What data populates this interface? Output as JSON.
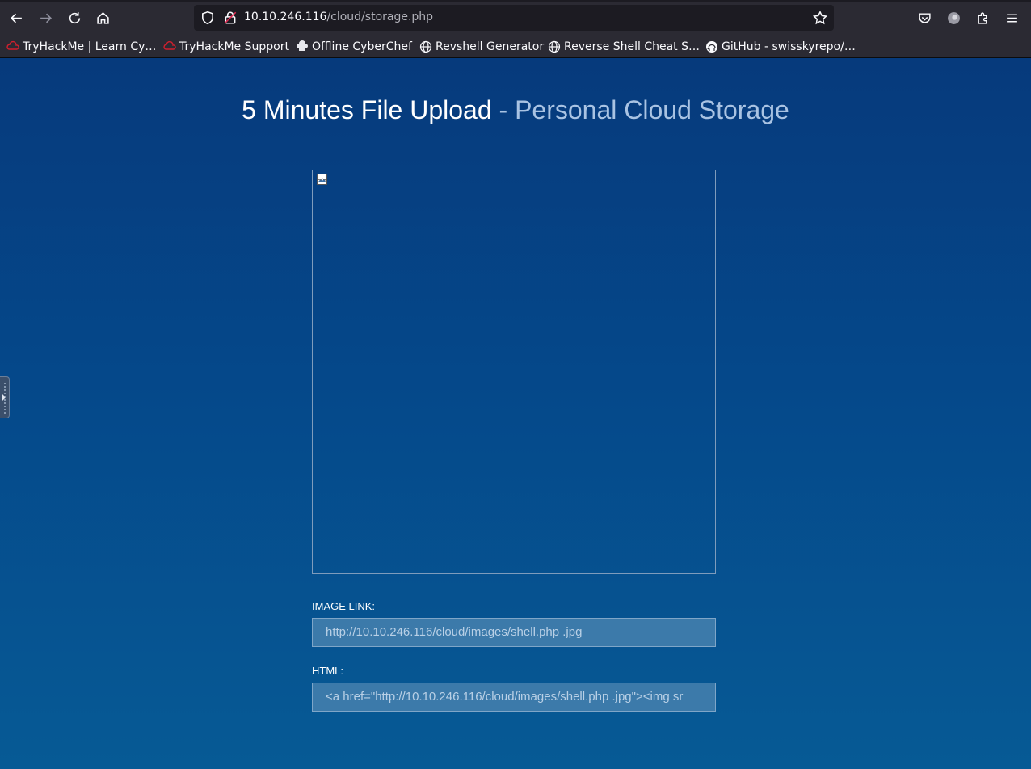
{
  "browser": {
    "url_host": "10.10.246.116",
    "url_path": "/cloud/storage.php",
    "bookmarks": [
      {
        "label": "TryHackMe | Learn Cy…",
        "icon": "tryhackme-icon"
      },
      {
        "label": "TryHackMe Support",
        "icon": "tryhackme-icon"
      },
      {
        "label": "Offline CyberChef",
        "icon": "chef-hat-icon"
      },
      {
        "label": "Revshell Generator",
        "icon": "globe-icon"
      },
      {
        "label": "Reverse Shell Cheat S…",
        "icon": "globe-icon"
      },
      {
        "label": "GitHub - swisskyrepo/…",
        "icon": "github-icon"
      }
    ]
  },
  "page": {
    "title_main": "5 Minutes File Upload",
    "title_sub": "- Personal Cloud Storage",
    "image_link_label": "IMAGE LINK:",
    "image_link_value": "http://10.10.246.116/cloud/images/shell.php .jpg",
    "html_label": "HTML:",
    "html_value": "<a href=\"http://10.10.246.116/cloud/images/shell.php .jpg\"><img sr"
  },
  "colors": {
    "page_gradient_top": "#063a7c",
    "page_gradient_bottom": "#065a95",
    "field_bg": "#3c7aaa"
  }
}
